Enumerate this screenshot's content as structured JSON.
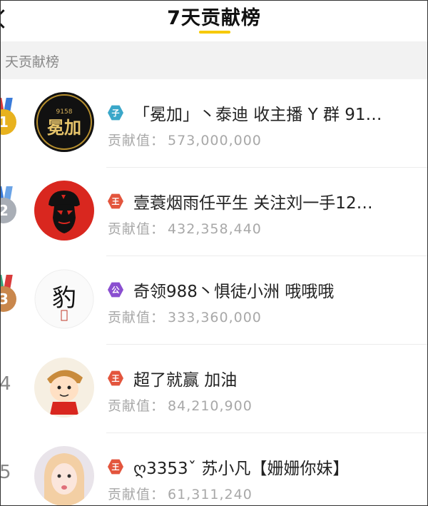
{
  "header": {
    "title": "7天贡献榜"
  },
  "section": {
    "label": "天贡献榜"
  },
  "colors": {
    "accent": "#f6c900",
    "gold": "#e8b21e",
    "silver": "#a9aeb6",
    "bronze": "#c9874c"
  },
  "entries": [
    {
      "rank": "1",
      "badge_char": "子",
      "badge_color": "#3aa7c9",
      "name": "「冕加」丶泰迪 收主播 Y 群 91…",
      "value_label": "贡献值：",
      "value": "573,000,000",
      "avatar_text": "冕加",
      "avatar_sub": "9158"
    },
    {
      "rank": "2",
      "badge_char": "王",
      "badge_color": "#e3553d",
      "name": "壹蓑烟雨任平生 关注刘一手12…",
      "value_label": "贡献值：",
      "value": "432,358,440"
    },
    {
      "rank": "3",
      "badge_char": "公",
      "badge_color": "#8a4fd0",
      "name": "奇领988丶惧徒小洲 哦哦哦",
      "value_label": "贡献值：",
      "value": "333,360,000",
      "avatar_text": "豹"
    },
    {
      "rank": "4",
      "badge_char": "王",
      "badge_color": "#e3553d",
      "name": "超了就赢 加油",
      "value_label": "贡献值：",
      "value": "84,210,900"
    },
    {
      "rank": "5",
      "badge_char": "王",
      "badge_color": "#e3553d",
      "name": "ღ3353ˇ 苏小凡【姗姗你妹】",
      "value_label": "贡献值：",
      "value": "61,311,240"
    }
  ]
}
